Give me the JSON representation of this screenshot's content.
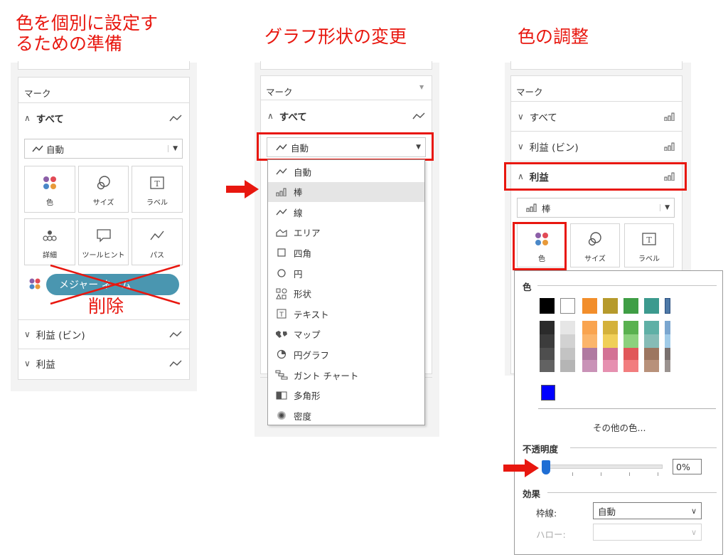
{
  "headings": {
    "left": "色を個別に設定す\nるための準備",
    "middle": "グラフ形状の変更",
    "right": "色の調整"
  },
  "left_panel": {
    "marks_title": "マーク",
    "all_label": "すべて",
    "mark_type": "自動",
    "buttons": [
      "色",
      "サイズ",
      "ラベル",
      "詳細",
      "ツールヒント",
      "パス"
    ],
    "pill_label": "メジャー ネーム",
    "delete_label": "削除",
    "rows": [
      "利益 (ビン)",
      "利益"
    ]
  },
  "middle_panel": {
    "marks_title": "マーク",
    "all_label": "すべて",
    "selected": "自動",
    "menu_items": [
      {
        "label": "自動",
        "icon": "line-icon"
      },
      {
        "label": "棒",
        "icon": "bar-icon"
      },
      {
        "label": "線",
        "icon": "line-icon"
      },
      {
        "label": "エリア",
        "icon": "area-icon"
      },
      {
        "label": "四角",
        "icon": "square-icon"
      },
      {
        "label": "円",
        "icon": "circle-icon"
      },
      {
        "label": "形状",
        "icon": "shape-icon"
      },
      {
        "label": "テキスト",
        "icon": "text-icon"
      },
      {
        "label": "マップ",
        "icon": "map-icon"
      },
      {
        "label": "円グラフ",
        "icon": "pie-icon"
      },
      {
        "label": "ガント チャート",
        "icon": "gantt-icon"
      },
      {
        "label": "多角形",
        "icon": "polygon-icon"
      },
      {
        "label": "密度",
        "icon": "density-icon"
      }
    ],
    "highlighted_index": 1
  },
  "right_panel": {
    "marks_title": "マーク",
    "rows": [
      "すべて",
      "利益 (ビン)",
      "利益"
    ],
    "mark_type": "棒",
    "buttons": [
      "色",
      "サイズ",
      "ラベル"
    ]
  },
  "color_popup": {
    "color_section": "色",
    "more_colors": "その他の色...",
    "opacity_label": "不透明度",
    "opacity_value": "0%",
    "opacity_level": 0,
    "effects_label": "効果",
    "border_label": "枠線:",
    "border_value": "自動",
    "halo_label": "ハロー:",
    "halo_value": ""
  },
  "colors": {
    "accent_red": "#e8170f",
    "pill_blue": "#4a96b0",
    "mark_dots": [
      "#8c5fa8",
      "#e24a55",
      "#4a88c8",
      "#e89a3a"
    ],
    "palette_columns": [
      [
        "#000000",
        "#2b2b2b",
        "#3c3c3c",
        "#4e4e4e",
        "#626262"
      ],
      [
        "#ffffff",
        "#e6e6e6",
        "#d2d2d2",
        "#c3c3c3",
        "#b5b5b5"
      ],
      [
        "#f28e2b",
        "#f9a44f",
        "#fbb56b",
        "#b07aa1",
        "#c992b7"
      ],
      [
        "#b69a2c",
        "#d4b13a",
        "#f0cf58",
        "#d37295",
        "#e690b0"
      ],
      [
        "#3f9e45",
        "#59b14f",
        "#8cd17d",
        "#e15759",
        "#f27d7e"
      ],
      [
        "#3c9a8e",
        "#5fb0a6",
        "#86bcb6",
        "#9d7660",
        "#b8917a"
      ],
      [
        "#4e79a7",
        "#7aa6cf",
        "#a0cbe8",
        "#79706e",
        "#9a928f"
      ]
    ],
    "extra_swatch": "#0000ff"
  }
}
